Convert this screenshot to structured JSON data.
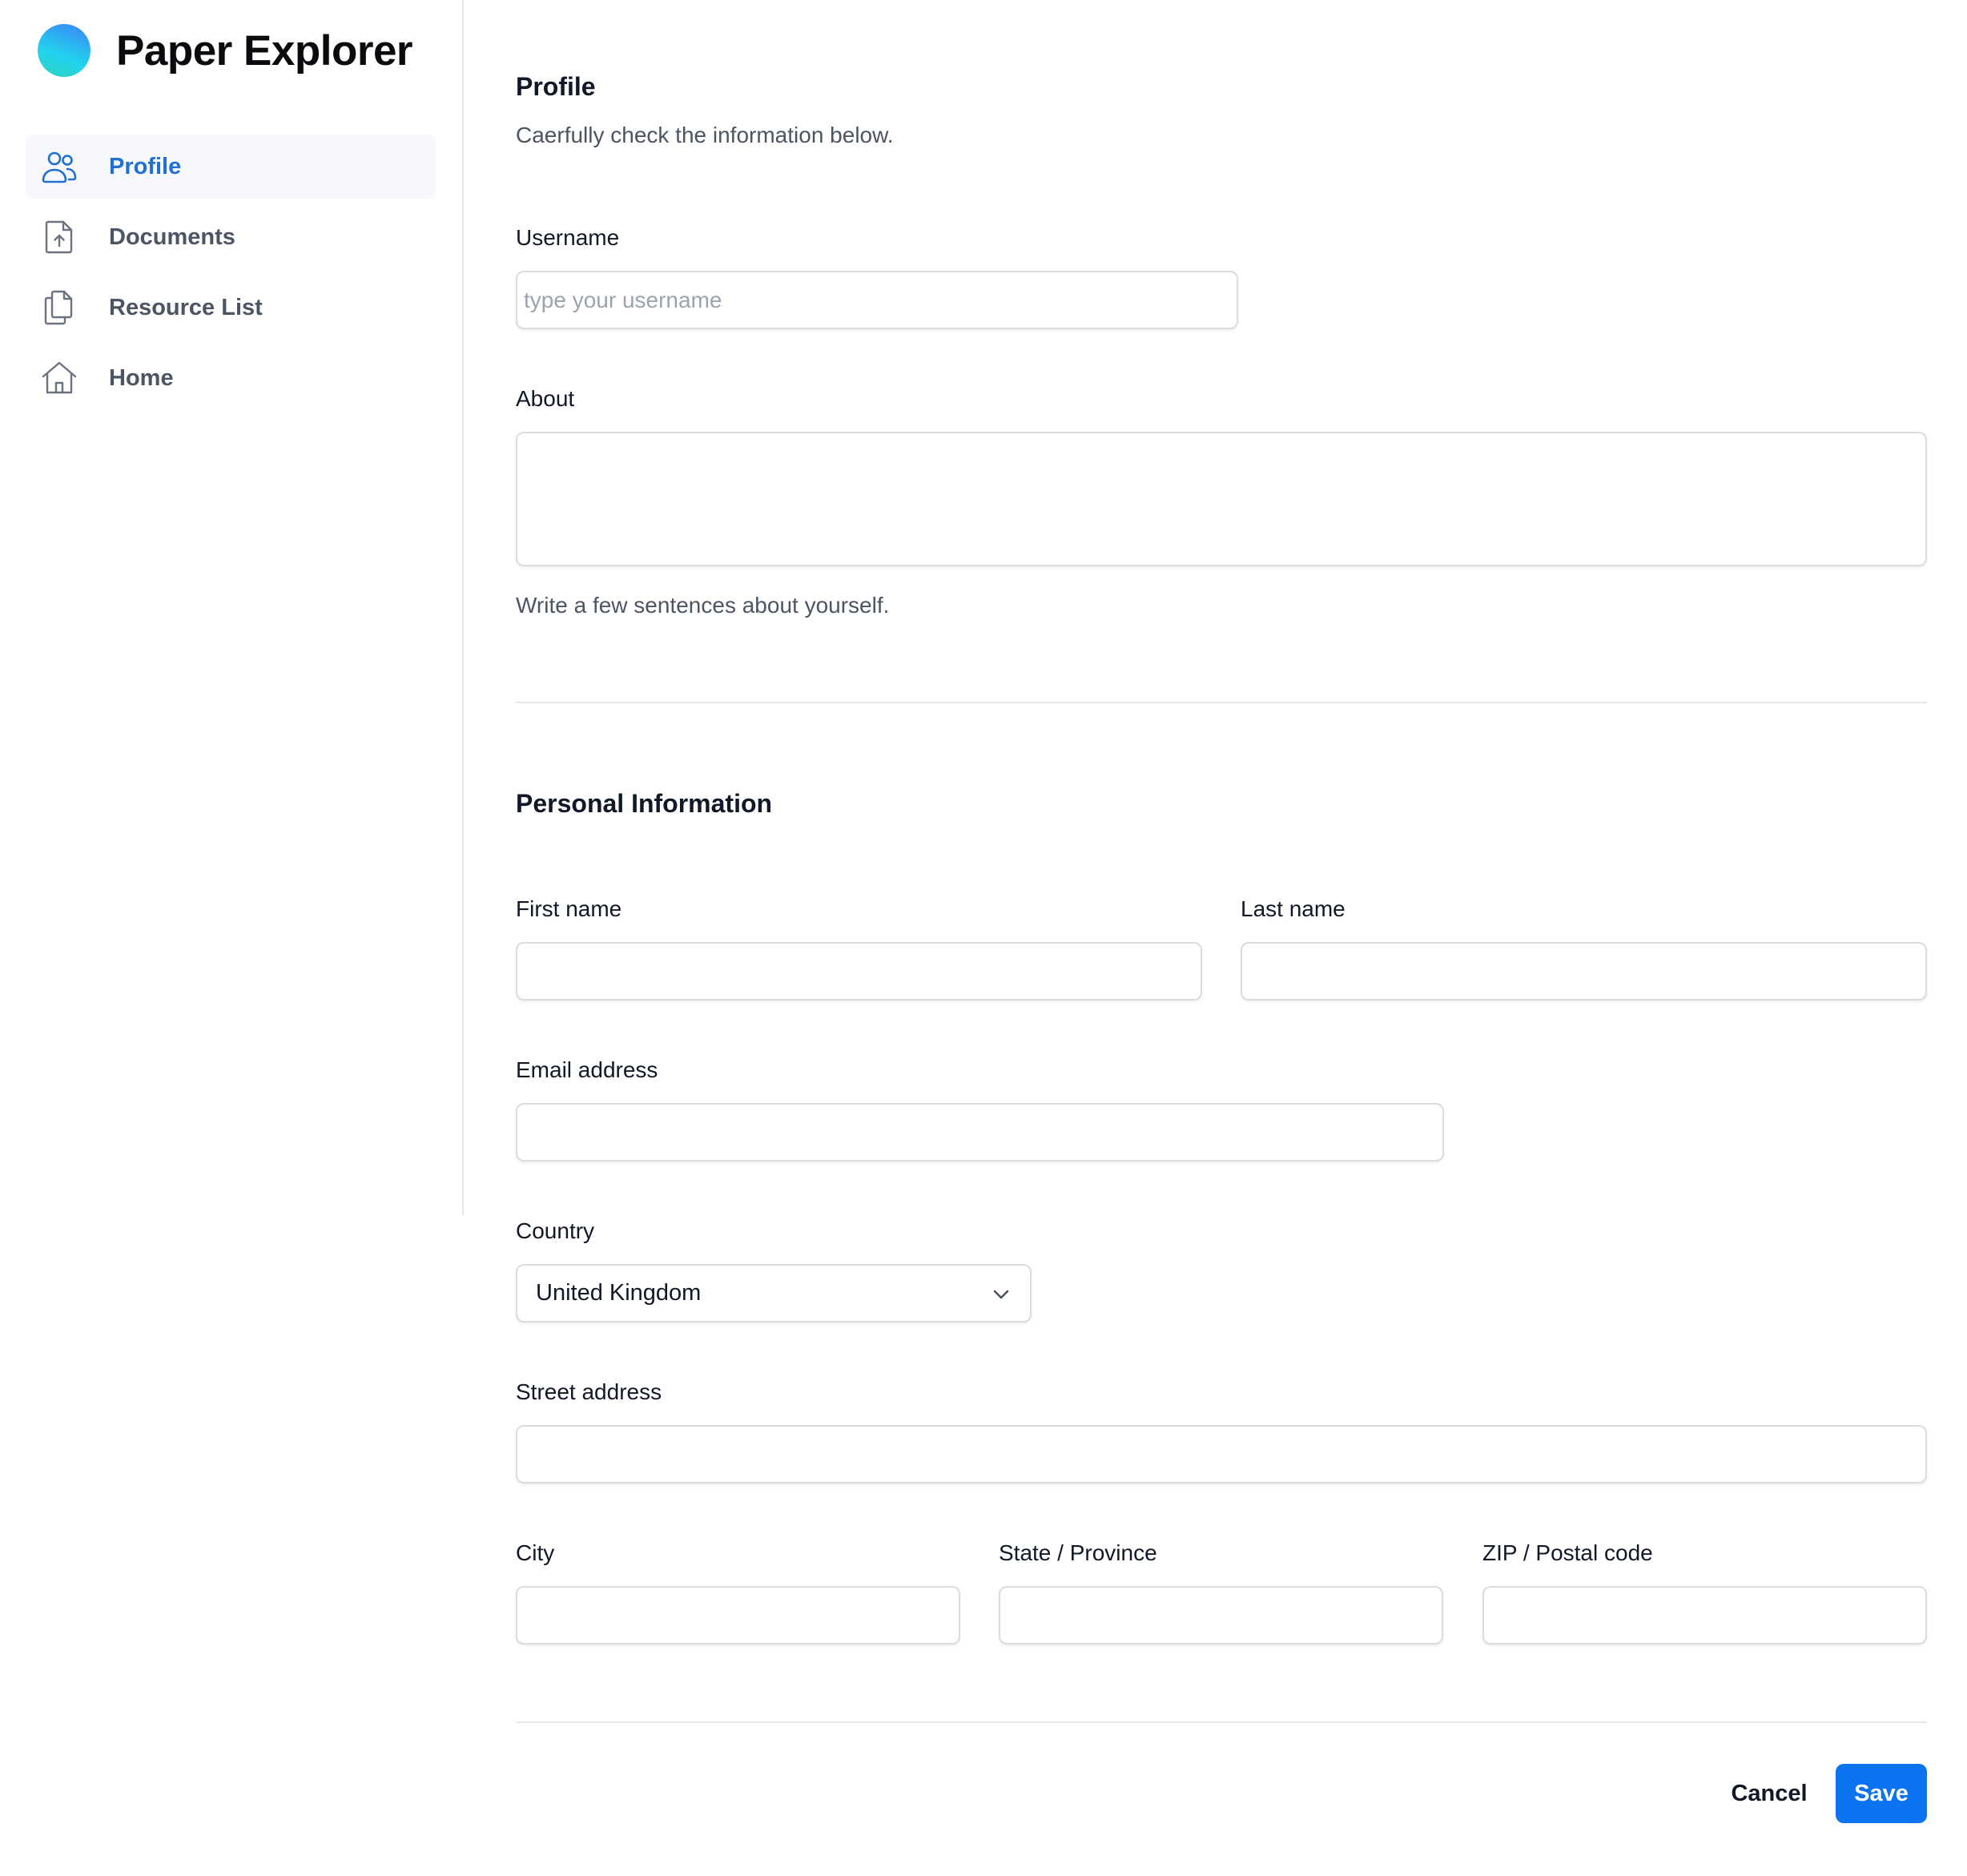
{
  "app": {
    "name": "Paper Explorer"
  },
  "sidebar": {
    "items": [
      {
        "label": "Profile",
        "icon": "users-icon",
        "active": true
      },
      {
        "label": "Documents",
        "icon": "document-upload-icon",
        "active": false
      },
      {
        "label": "Resource List",
        "icon": "documents-copy-icon",
        "active": false
      },
      {
        "label": "Home",
        "icon": "home-icon",
        "active": false
      }
    ]
  },
  "profile": {
    "title": "Profile",
    "subtitle": "Caerfully check the information below.",
    "username_label": "Username",
    "username_placeholder": "type your username",
    "username_value": "",
    "about_label": "About",
    "about_value": "",
    "about_hint": "Write a few sentences about yourself."
  },
  "personal": {
    "title": "Personal Information",
    "first_name_label": "First name",
    "first_name_value": "",
    "last_name_label": "Last name",
    "last_name_value": "",
    "email_label": "Email address",
    "email_value": "",
    "country_label": "Country",
    "country_value": "United Kingdom",
    "street_label": "Street address",
    "street_value": "",
    "city_label": "City",
    "city_value": "",
    "state_label": "State / Province",
    "state_value": "",
    "zip_label": "ZIP / Postal code",
    "zip_value": ""
  },
  "actions": {
    "cancel_label": "Cancel",
    "save_label": "Save"
  },
  "colors": {
    "accent": "#0b73f0",
    "active_nav_text": "#1f6fd4",
    "active_nav_bg": "#f6f8fb",
    "border": "#d9dce1"
  }
}
